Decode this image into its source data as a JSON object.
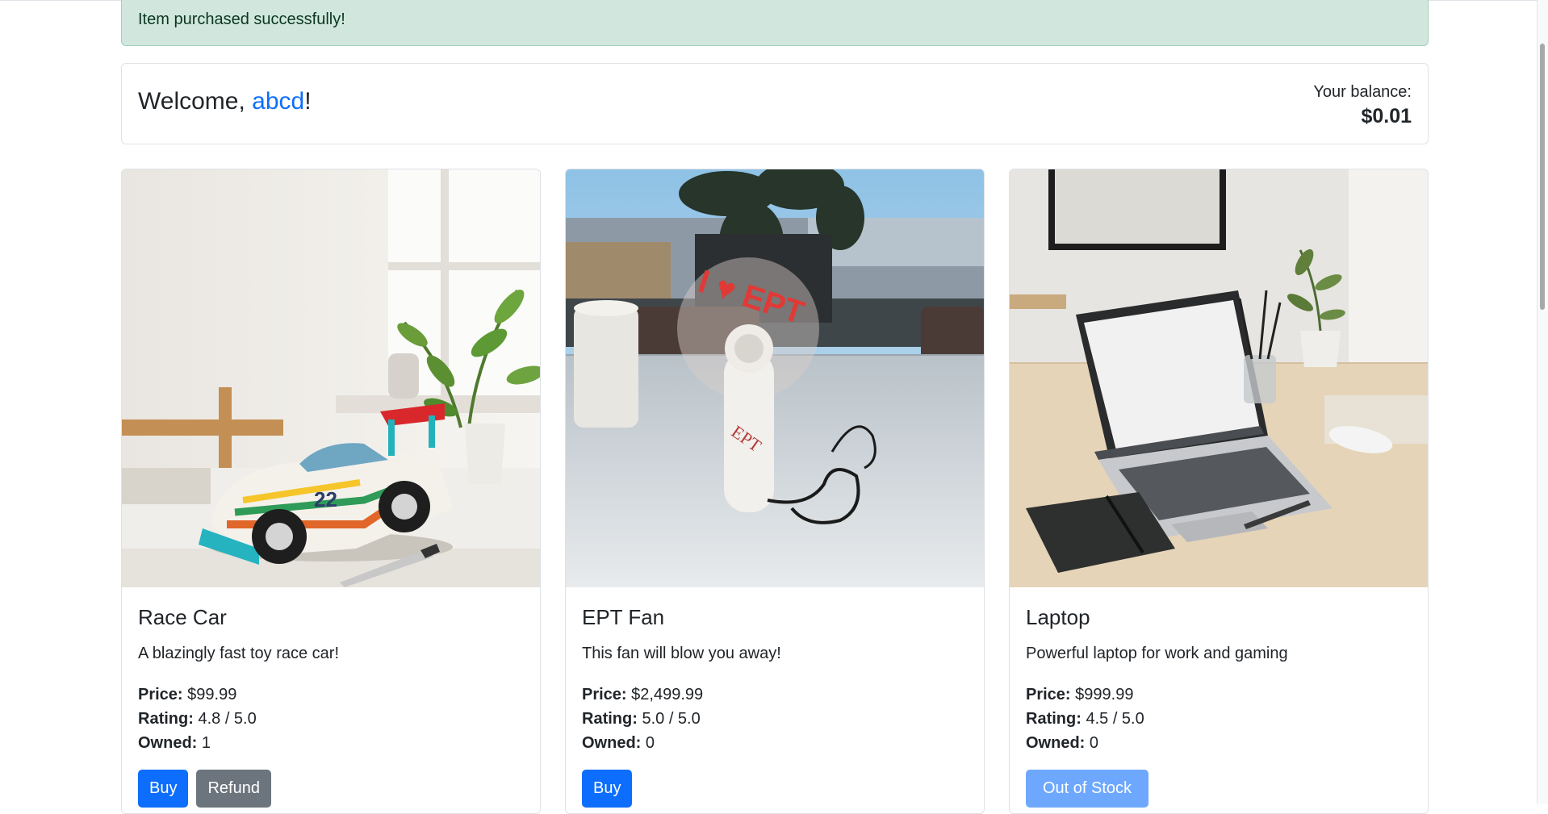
{
  "alert": {
    "message": "Item purchased successfully!"
  },
  "welcome": {
    "prefix": "Welcome, ",
    "username": "abcd",
    "suffix": "!",
    "balance_label": "Your balance:",
    "balance_value": "$0.01"
  },
  "labels": {
    "price": "Price:",
    "rating": "Rating:",
    "owned": "Owned:"
  },
  "products": [
    {
      "name": "Race Car",
      "description": "A blazingly fast toy race car!",
      "price": "$99.99",
      "rating": "4.8 / 5.0",
      "owned": "1",
      "image_icon": "race-car-photo",
      "buy_label": "Buy",
      "refund_label": "Refund"
    },
    {
      "name": "EPT Fan",
      "description": "This fan will blow you away!",
      "price": "$2,499.99",
      "rating": "5.0 / 5.0",
      "owned": "0",
      "image_icon": "fan-photo",
      "image_text": "I ♥ EPT",
      "fan_text": "EPT",
      "buy_label": "Buy"
    },
    {
      "name": "Laptop",
      "description": "Powerful laptop for work and gaming",
      "price": "$999.99",
      "rating": "4.5 / 5.0",
      "owned": "0",
      "image_icon": "laptop-photo",
      "stock_label": "Out of Stock"
    }
  ],
  "colors": {
    "primary": "#0d6efd",
    "secondary": "#6c757d",
    "disabled_primary": "#6ea8fe",
    "alert_bg": "#d1e7dd",
    "alert_text": "#0a3622"
  }
}
